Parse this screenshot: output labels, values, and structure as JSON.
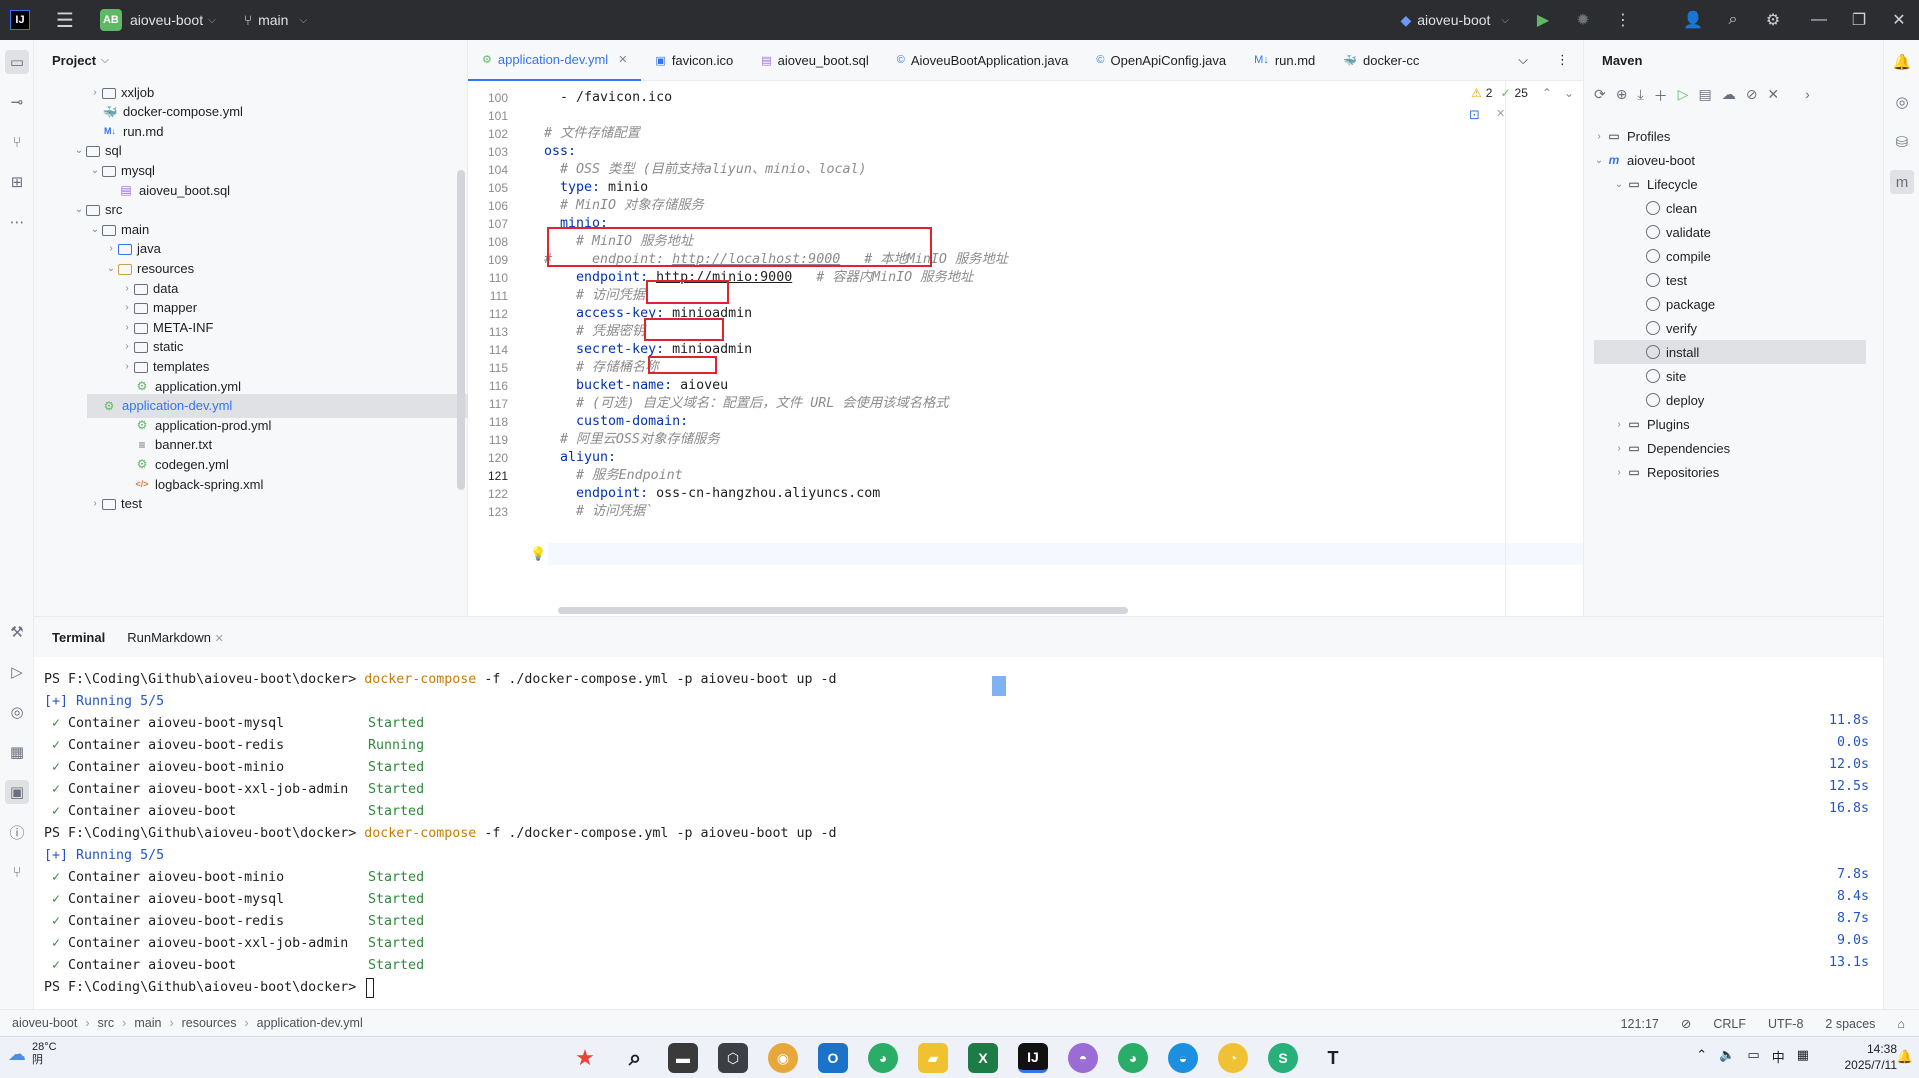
{
  "titlebar": {
    "project_badge": "AB",
    "project_name": "aioveu-boot",
    "branch": "main",
    "run_config": "aioveu-boot"
  },
  "project_panel": {
    "title": "Project",
    "items": [
      {
        "label": "xxljob",
        "kind": "folder"
      },
      {
        "label": "docker-compose.yml",
        "kind": "docker"
      },
      {
        "label": "run.md",
        "kind": "md"
      },
      {
        "label": "sql",
        "kind": "folder"
      },
      {
        "label": "mysql",
        "kind": "folder"
      },
      {
        "label": "aioveu_boot.sql",
        "kind": "sql"
      },
      {
        "label": "src",
        "kind": "folder"
      },
      {
        "label": "main",
        "kind": "folder"
      },
      {
        "label": "java",
        "kind": "folder-blue"
      },
      {
        "label": "resources",
        "kind": "folder-res"
      },
      {
        "label": "data",
        "kind": "folder"
      },
      {
        "label": "mapper",
        "kind": "folder"
      },
      {
        "label": "META-INF",
        "kind": "folder"
      },
      {
        "label": "static",
        "kind": "folder"
      },
      {
        "label": "templates",
        "kind": "folder"
      },
      {
        "label": "application.yml",
        "kind": "yml"
      },
      {
        "label": "application-dev.yml",
        "kind": "yml",
        "selected": true
      },
      {
        "label": "application-prod.yml",
        "kind": "yml"
      },
      {
        "label": "banner.txt",
        "kind": "txt"
      },
      {
        "label": "codegen.yml",
        "kind": "yml"
      },
      {
        "label": "logback-spring.xml",
        "kind": "xml"
      },
      {
        "label": "test",
        "kind": "folder"
      }
    ]
  },
  "tabs": [
    {
      "label": "application-dev.yml",
      "active": true
    },
    {
      "label": "favicon.ico"
    },
    {
      "label": "aioveu_boot.sql"
    },
    {
      "label": "AioveuBootApplication.java"
    },
    {
      "label": "OpenApiConfig.java"
    },
    {
      "label": "run.md"
    },
    {
      "label": "docker-cc"
    }
  ],
  "editor": {
    "inspections": {
      "warnings": "2",
      "ok": "25"
    },
    "current_line": "121",
    "lines": [
      {
        "n": "100",
        "text": "  - /favicon.ico"
      },
      {
        "n": "101",
        "text": ""
      },
      {
        "n": "102",
        "text": "# 文件存储配置"
      },
      {
        "n": "103",
        "text": "oss:"
      },
      {
        "n": "104",
        "text": "  # OSS 类型 (目前支持aliyun、minio、local)"
      },
      {
        "n": "105",
        "text": "  type: minio"
      },
      {
        "n": "106",
        "text": "  # MinIO 对象存储服务"
      },
      {
        "n": "107",
        "text": "  minio:"
      },
      {
        "n": "108",
        "text": "    # MinIO 服务地址"
      },
      {
        "n": "109",
        "text": "#     endpoint: http://localhost:9000   # 本地MinIO 服务地址"
      },
      {
        "n": "110",
        "text": "    endpoint: http://minio:9000   # 容器内MinIO 服务地址"
      },
      {
        "n": "111",
        "text": "    # 访问凭据"
      },
      {
        "n": "112",
        "text": "    access-key: minioadmin"
      },
      {
        "n": "113",
        "text": "    # 凭据密钥"
      },
      {
        "n": "114",
        "text": "    secret-key: minioadmin"
      },
      {
        "n": "115",
        "text": "    # 存储桶名称"
      },
      {
        "n": "116",
        "text": "    bucket-name: aioveu"
      },
      {
        "n": "117",
        "text": "    # (可选) 自定义域名：配置后，文件 URL 会使用该域名格式"
      },
      {
        "n": "118",
        "text": "    custom-domain:"
      },
      {
        "n": "119",
        "text": "  # 阿里云OSS对象存储服务"
      },
      {
        "n": "120",
        "text": "  aliyun:"
      },
      {
        "n": "121",
        "text": "    # 服务Endpoint"
      },
      {
        "n": "122",
        "text": "    endpoint: oss-cn-hangzhou.aliyuncs.com"
      },
      {
        "n": "123",
        "text": "    # 访问凭据`"
      }
    ]
  },
  "maven": {
    "title": "Maven",
    "profiles": "Profiles",
    "project": "aioveu-boot",
    "lifecycle": "Lifecycle",
    "goals": [
      "clean",
      "validate",
      "compile",
      "test",
      "package",
      "verify",
      "install",
      "site",
      "deploy"
    ],
    "selected_goal": "install",
    "plugins": "Plugins",
    "dependencies": "Dependencies",
    "repositories": "Repositories"
  },
  "terminal": {
    "tabs": [
      "Terminal",
      "RunMarkdown"
    ],
    "prompt": "PS F:\\Coding\\Github\\aioveu-boot\\docker>",
    "command": "docker-compose",
    "args": " -f ./docker-compose.yml -p aioveu-boot up -d",
    "runs": [
      {
        "running": "[+] Running 5/5",
        "containers": [
          {
            "name": "Container aioveu-boot-mysql",
            "state": "Started",
            "time": "11.8s"
          },
          {
            "name": "Container aioveu-boot-redis",
            "state": "Running",
            "time": "0.0s"
          },
          {
            "name": "Container aioveu-boot-minio",
            "state": "Started",
            "time": "12.0s"
          },
          {
            "name": "Container aioveu-boot-xxl-job-admin",
            "state": "Started",
            "time": "12.5s"
          },
          {
            "name": "Container aioveu-boot",
            "state": "Started",
            "time": "16.8s"
          }
        ]
      },
      {
        "running": "[+] Running 5/5",
        "containers": [
          {
            "name": "Container aioveu-boot-minio",
            "state": "Started",
            "time": "7.8s"
          },
          {
            "name": "Container aioveu-boot-mysql",
            "state": "Started",
            "time": "8.4s"
          },
          {
            "name": "Container aioveu-boot-redis",
            "state": "Started",
            "time": "8.7s"
          },
          {
            "name": "Container aioveu-boot-xxl-job-admin",
            "state": "Started",
            "time": "9.0s"
          },
          {
            "name": "Container aioveu-boot",
            "state": "Started",
            "time": "13.1s"
          }
        ]
      }
    ]
  },
  "statusbar": {
    "breadcrumb": [
      "aioveu-boot",
      "src",
      "main",
      "resources",
      "application-dev.yml"
    ],
    "position": "121:17",
    "line_ending": "CRLF",
    "encoding": "UTF-8",
    "indent": "2 spaces"
  },
  "taskbar": {
    "temperature": "28°C",
    "weather": "阴",
    "time": "14:38",
    "date": "2025/7/11",
    "ime": "中"
  }
}
